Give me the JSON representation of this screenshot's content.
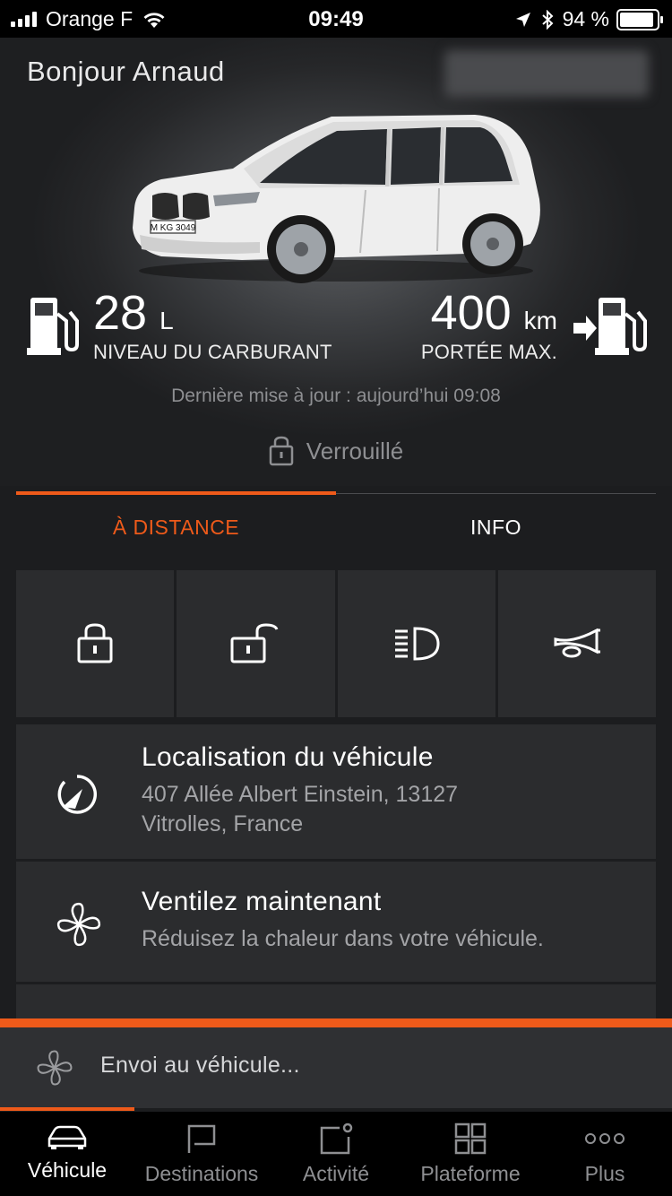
{
  "status_bar": {
    "carrier": "Orange F",
    "time": "09:49",
    "battery": "94 %"
  },
  "hero": {
    "greeting": "Bonjour Arnaud",
    "license_plate": "M KG 3049",
    "fuel": {
      "value": "28",
      "unit": "L",
      "label": "NIVEAU DU CARBURANT"
    },
    "range": {
      "value": "400",
      "unit": "km",
      "label": "PORTÉE MAX."
    },
    "last_update": "Dernière mise à jour : aujourd’hui 09:08",
    "lock_status": "Verrouillé"
  },
  "tabs": [
    {
      "label": "À DISTANCE",
      "active": true
    },
    {
      "label": "INFO",
      "active": false
    }
  ],
  "remote_actions": [
    {
      "icon": "lock-icon"
    },
    {
      "icon": "unlock-icon"
    },
    {
      "icon": "headlight-icon"
    },
    {
      "icon": "horn-icon"
    }
  ],
  "list": [
    {
      "icon": "location-icon",
      "title": "Localisation du véhicule",
      "subtitle_line1": "407 Allée Albert Einstein, 13127",
      "subtitle_line2": "Vitrolles, France"
    },
    {
      "icon": "fan-icon",
      "title": "Ventilez maintenant",
      "subtitle": "Réduisez la chaleur dans votre véhicule."
    }
  ],
  "toast": {
    "text": "Envoi au véhicule...",
    "progress": 0.2
  },
  "bottom_nav": [
    {
      "label": "Véhicule",
      "icon": "car-icon",
      "active": true
    },
    {
      "label": "Destinations",
      "icon": "flag-icon",
      "active": false
    },
    {
      "label": "Activité",
      "icon": "activity-icon",
      "active": false
    },
    {
      "label": "Plateforme",
      "icon": "grid-icon",
      "active": false
    },
    {
      "label": "Plus",
      "icon": "more-icon",
      "active": false
    }
  ],
  "colors": {
    "accent": "#ee5a1a",
    "background": "#1c1d1f",
    "card": "#2b2c2e"
  }
}
